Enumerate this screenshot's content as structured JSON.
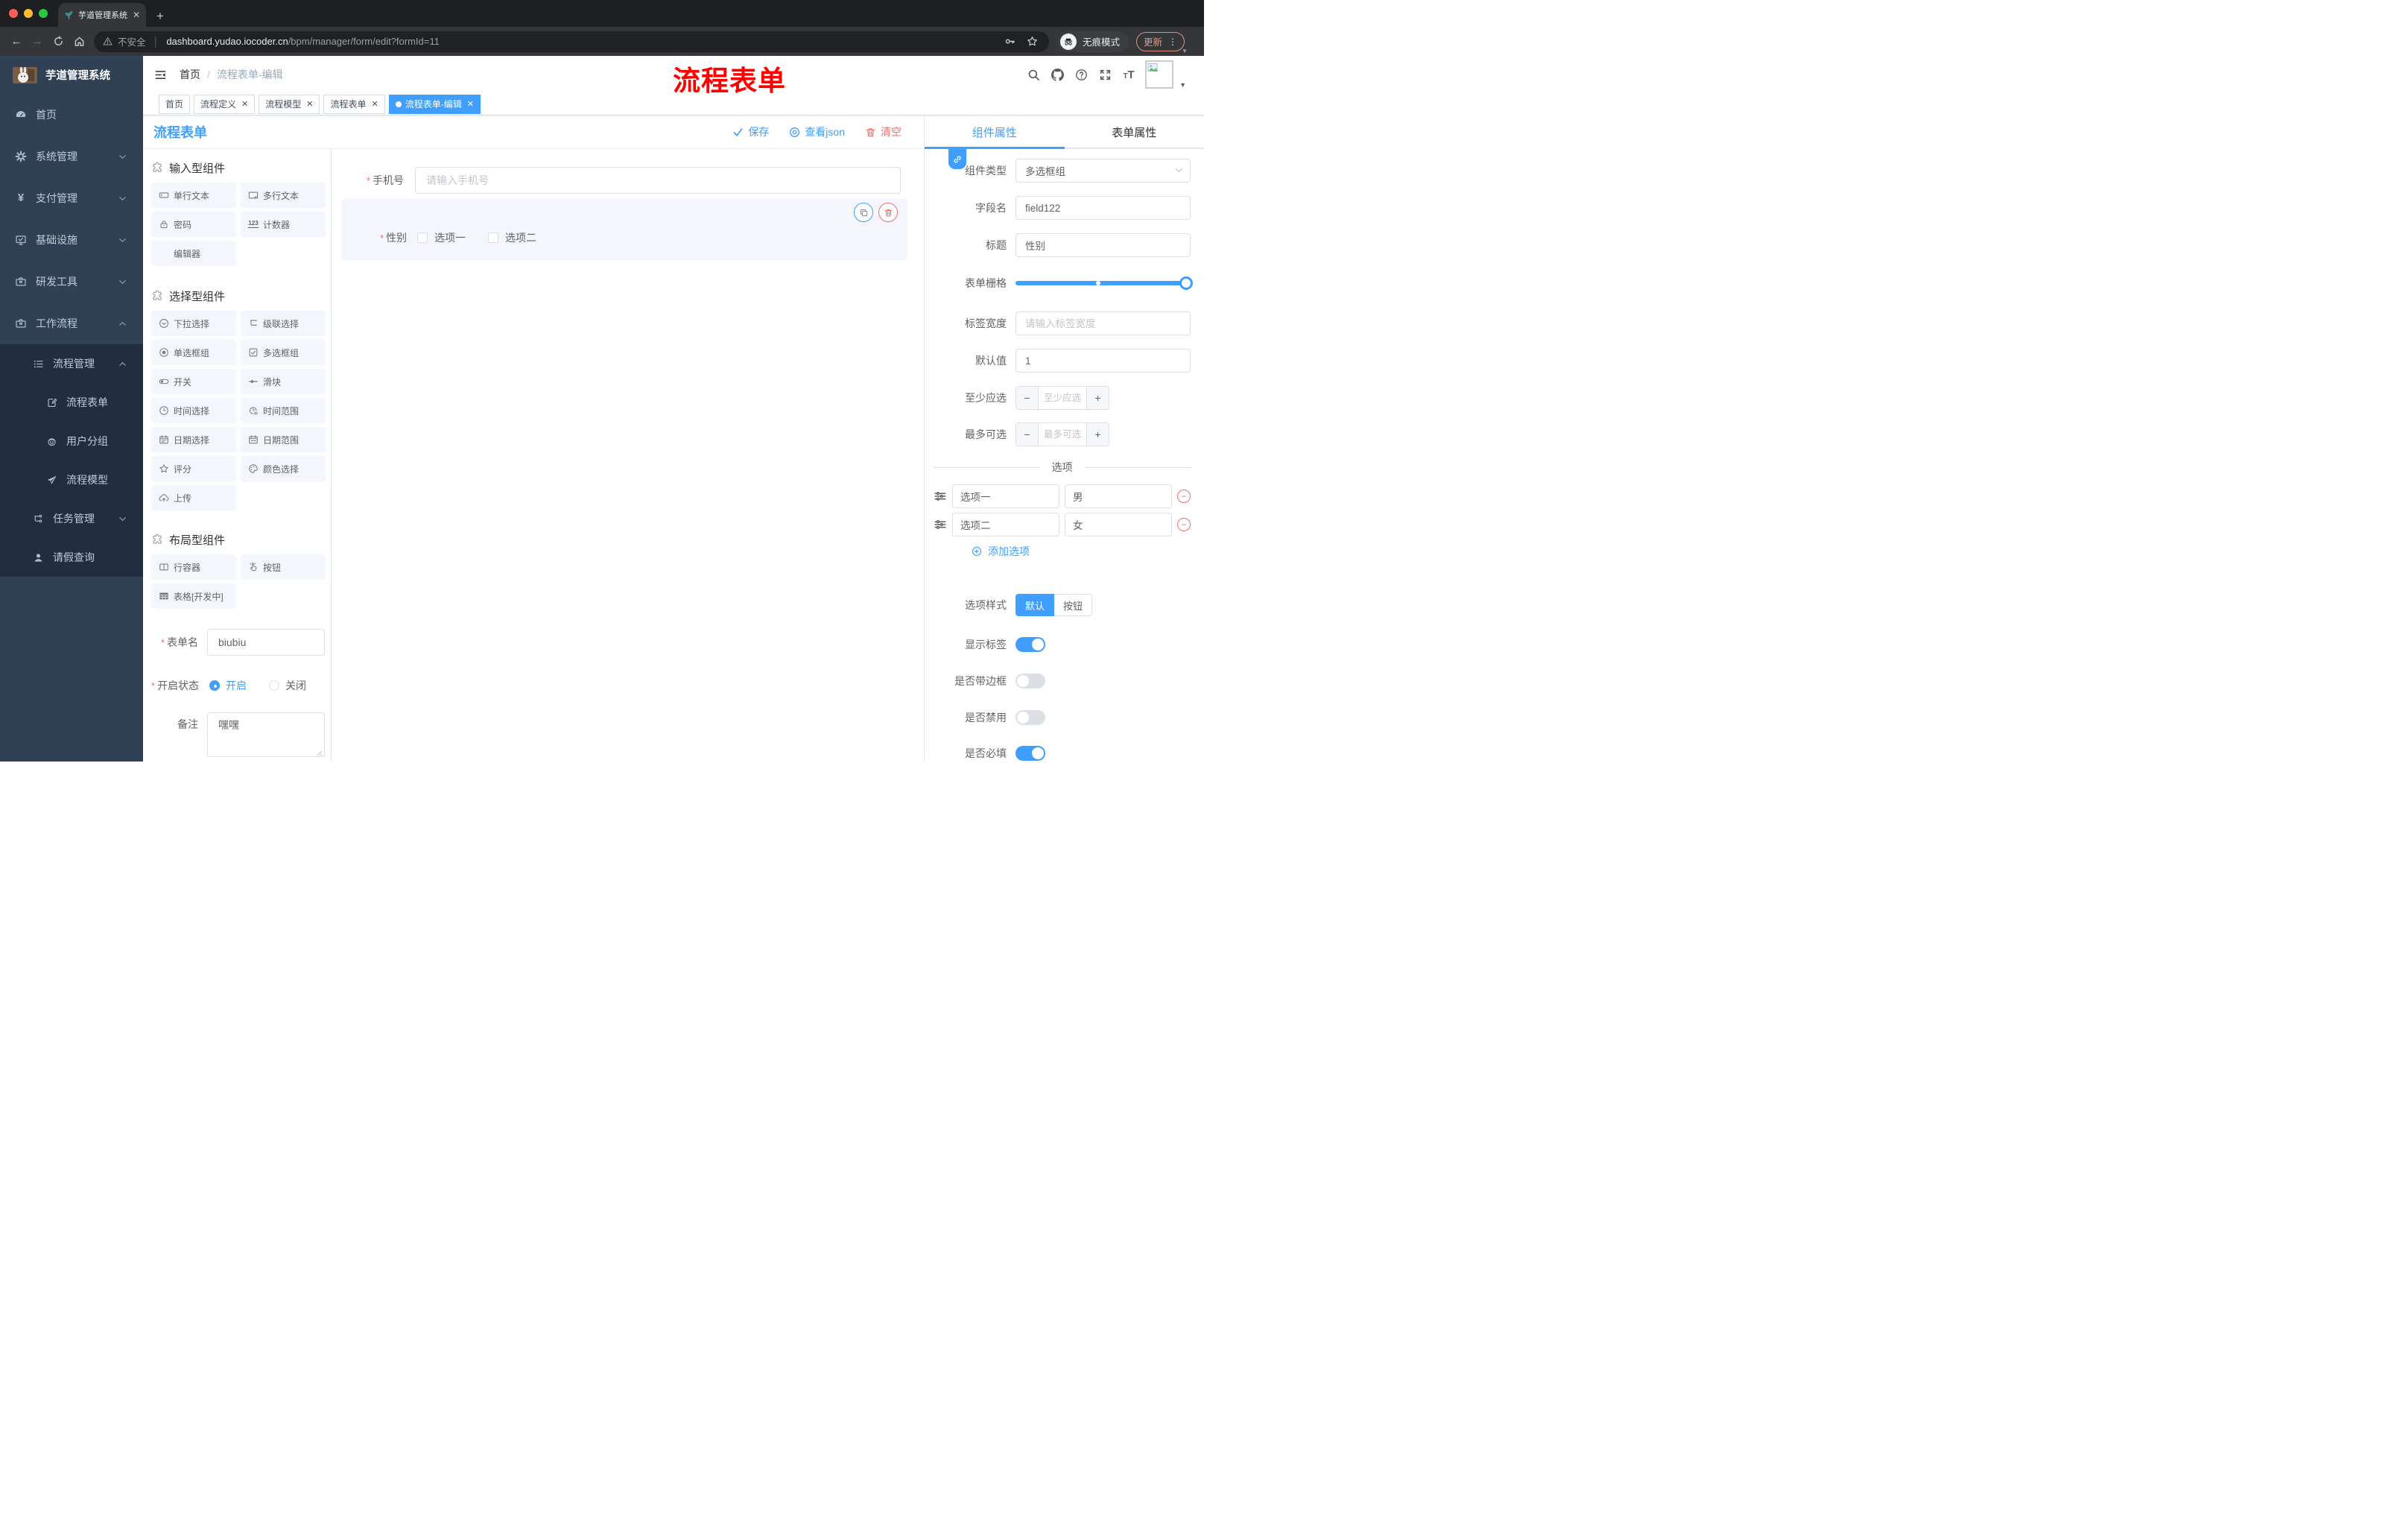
{
  "browser": {
    "tab_title": "芋道管理系统",
    "security_label": "不安全",
    "url_host": "dashboard.yudao.iocoder.cn",
    "url_path": "/bpm/manager/form/edit?formId=11",
    "incognito_label": "无痕模式",
    "update_label": "更新"
  },
  "sidebar": {
    "logo_title": "芋道管理系统",
    "items": [
      {
        "label": "首页"
      },
      {
        "label": "系统管理"
      },
      {
        "label": "支付管理"
      },
      {
        "label": "基础设施"
      },
      {
        "label": "研发工具"
      },
      {
        "label": "工作流程"
      },
      {
        "label": "流程管理"
      },
      {
        "label": "流程表单"
      },
      {
        "label": "用户分组"
      },
      {
        "label": "流程模型"
      },
      {
        "label": "任务管理"
      },
      {
        "label": "请假查询"
      }
    ]
  },
  "header": {
    "breadcrumb_home": "首页",
    "breadcrumb_sep": "/",
    "breadcrumb_current": "流程表单-编辑",
    "watermark": "流程表单"
  },
  "tags": {
    "items": [
      {
        "label": "首页"
      },
      {
        "label": "流程定义"
      },
      {
        "label": "流程模型"
      },
      {
        "label": "流程表单"
      },
      {
        "label": "流程表单-编辑"
      }
    ]
  },
  "toolbar": {
    "panel_title": "流程表单",
    "save_label": "保存",
    "view_json_label": "查看json",
    "clear_label": "清空"
  },
  "components": {
    "sections": [
      {
        "title": "输入型组件",
        "items": [
          {
            "icon": "text-input-icon",
            "label": "单行文本"
          },
          {
            "icon": "textarea-icon",
            "label": "多行文本"
          },
          {
            "icon": "password-icon",
            "label": "密码"
          },
          {
            "icon": "counter-icon",
            "label": "计数器"
          },
          {
            "icon": "none",
            "label": "编辑器"
          }
        ]
      },
      {
        "title": "选择型组件",
        "items": [
          {
            "icon": "select-icon",
            "label": "下拉选择"
          },
          {
            "icon": "cascader-icon",
            "label": "级联选择"
          },
          {
            "icon": "radio-group-icon",
            "label": "单选框组"
          },
          {
            "icon": "checkbox-group-icon",
            "label": "多选框组"
          },
          {
            "icon": "switch-icon",
            "label": "开关"
          },
          {
            "icon": "slider-icon",
            "label": "滑块"
          },
          {
            "icon": "time-picker-icon",
            "label": "时间选择"
          },
          {
            "icon": "time-range-icon",
            "label": "时间范围"
          },
          {
            "icon": "date-picker-icon",
            "label": "日期选择"
          },
          {
            "icon": "date-range-icon",
            "label": "日期范围"
          },
          {
            "icon": "rate-icon",
            "label": "评分"
          },
          {
            "icon": "color-picker-icon",
            "label": "颜色选择"
          },
          {
            "icon": "upload-icon",
            "label": "上传"
          }
        ]
      },
      {
        "title": "布局型组件",
        "items": [
          {
            "icon": "row-container-icon",
            "label": "行容器"
          },
          {
            "icon": "button-icon",
            "label": "按钮"
          },
          {
            "icon": "table-icon",
            "label": "表格[开发中]"
          }
        ]
      }
    ]
  },
  "form_config": {
    "name_label": "表单名",
    "name_value": "biubiu",
    "status_label": "开启状态",
    "status_on": "开启",
    "status_off": "关闭",
    "remark_label": "备注",
    "remark_value": "嘿嘿"
  },
  "canvas": {
    "phone_label": "手机号",
    "phone_placeholder": "请输入手机号",
    "gender_label": "性别",
    "gender_options": [
      "选项一",
      "选项二"
    ]
  },
  "properties": {
    "tab_component": "组件属性",
    "tab_form": "表单属性",
    "type_label": "组件类型",
    "type_value": "多选框组",
    "field_label": "字段名",
    "field_value": "field122",
    "title_label": "标题",
    "title_value": "性别",
    "grid_label": "表单栅格",
    "label_width_label": "标签宽度",
    "label_width_placeholder": "请输入标签宽度",
    "default_label": "默认值",
    "default_value": "1",
    "min_label": "至少应选",
    "min_placeholder": "至少应选",
    "max_label": "最多可选",
    "max_placeholder": "最多可选",
    "options_divider": "选项",
    "options": [
      {
        "label": "选项一",
        "value": "男"
      },
      {
        "label": "选项二",
        "value": "女"
      }
    ],
    "add_option": "添加选项",
    "style_label": "选项样式",
    "style_default": "默认",
    "style_button": "按钮",
    "show_label": "显示标签",
    "border_label": "是否带边框",
    "disabled_label": "是否禁用",
    "required_label": "是否必填"
  },
  "colors": {
    "primary": "#409eff",
    "danger": "#f56c6c",
    "watermark": "#ff0000"
  }
}
